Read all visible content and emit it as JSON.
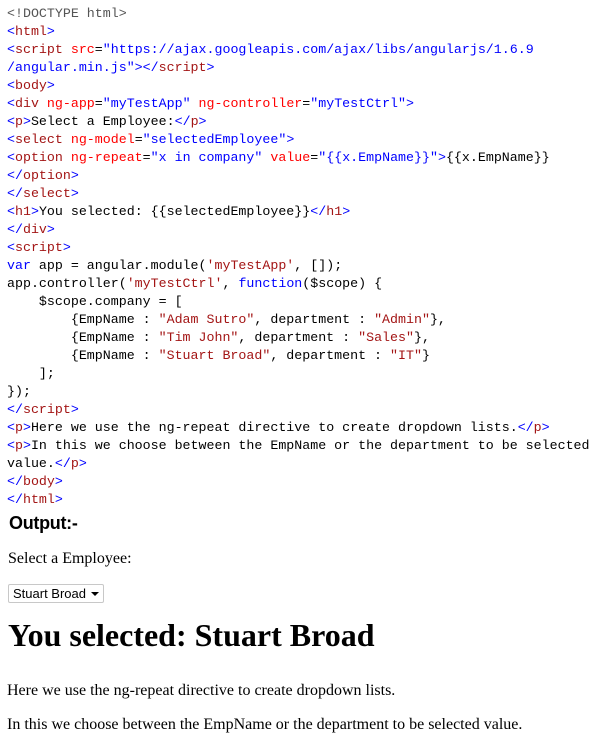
{
  "code": {
    "lines": [
      [
        [
          "d",
          "<!DOCTYPE html>"
        ]
      ],
      [
        [
          "b",
          "<"
        ],
        [
          "t",
          "html"
        ],
        [
          "b",
          ">"
        ]
      ],
      [
        [
          "b",
          "<"
        ],
        [
          "t",
          "script "
        ],
        [
          "a",
          "src"
        ],
        [
          "p",
          "="
        ],
        [
          "v",
          "\"https://ajax.googleapis.com/ajax/libs/angularjs/1.6.9"
        ]
      ],
      [
        [
          "v",
          "/angular.min.js\""
        ],
        [
          "b",
          "></"
        ],
        [
          "t",
          "script"
        ],
        [
          "b",
          ">"
        ]
      ],
      [
        [
          "b",
          "<"
        ],
        [
          "t",
          "body"
        ],
        [
          "b",
          ">"
        ]
      ],
      [
        [
          "b",
          "<"
        ],
        [
          "t",
          "div "
        ],
        [
          "a",
          "ng-app"
        ],
        [
          "p",
          "="
        ],
        [
          "v",
          "\"myTestApp\" "
        ],
        [
          "a",
          "ng-controller"
        ],
        [
          "p",
          "="
        ],
        [
          "v",
          "\"myTestCtrl\""
        ],
        [
          "b",
          ">"
        ]
      ],
      [
        [
          "b",
          "<"
        ],
        [
          "t",
          "p"
        ],
        [
          "b",
          ">"
        ],
        [
          "p",
          "Select a Employee:"
        ],
        [
          "b",
          "</"
        ],
        [
          "t",
          "p"
        ],
        [
          "b",
          ">"
        ]
      ],
      [
        [
          "b",
          "<"
        ],
        [
          "t",
          "select "
        ],
        [
          "a",
          "ng-model"
        ],
        [
          "p",
          "="
        ],
        [
          "v",
          "\"selectedEmployee\""
        ],
        [
          "b",
          ">"
        ]
      ],
      [
        [
          "b",
          "<"
        ],
        [
          "t",
          "option "
        ],
        [
          "a",
          "ng-repeat"
        ],
        [
          "p",
          "="
        ],
        [
          "v",
          "\"x in company\" "
        ],
        [
          "a",
          "value"
        ],
        [
          "p",
          "="
        ],
        [
          "v",
          "\"{{x.EmpName}}\""
        ],
        [
          "b",
          ">"
        ],
        [
          "p",
          "{{x.EmpName}}"
        ]
      ],
      [
        [
          "b",
          "</"
        ],
        [
          "t",
          "option"
        ],
        [
          "b",
          ">"
        ]
      ],
      [
        [
          "b",
          "</"
        ],
        [
          "t",
          "select"
        ],
        [
          "b",
          ">"
        ]
      ],
      [
        [
          "b",
          "<"
        ],
        [
          "t",
          "h1"
        ],
        [
          "b",
          ">"
        ],
        [
          "p",
          "You selected: {{selectedEmployee}}"
        ],
        [
          "b",
          "</"
        ],
        [
          "t",
          "h1"
        ],
        [
          "b",
          ">"
        ]
      ],
      [
        [
          "b",
          "</"
        ],
        [
          "t",
          "div"
        ],
        [
          "b",
          ">"
        ]
      ],
      [
        [
          "b",
          "<"
        ],
        [
          "t",
          "script"
        ],
        [
          "b",
          ">"
        ]
      ],
      [
        [
          "k",
          "var"
        ],
        [
          "p",
          " app = angular.module("
        ],
        [
          "s",
          "'myTestApp'"
        ],
        [
          "p",
          ", []);"
        ]
      ],
      [
        [
          "p",
          "app.controller("
        ],
        [
          "s",
          "'myTestCtrl'"
        ],
        [
          "p",
          ", "
        ],
        [
          "k",
          "function"
        ],
        [
          "p",
          "($scope) {"
        ]
      ],
      [
        [
          "p",
          "    $scope.company = ["
        ]
      ],
      [
        [
          "p",
          "        {EmpName : "
        ],
        [
          "s",
          "\"Adam Sutro\""
        ],
        [
          "p",
          ", department : "
        ],
        [
          "s",
          "\"Admin\""
        ],
        [
          "p",
          "},"
        ]
      ],
      [
        [
          "p",
          "        {EmpName : "
        ],
        [
          "s",
          "\"Tim John\""
        ],
        [
          "p",
          ", department : "
        ],
        [
          "s",
          "\"Sales\""
        ],
        [
          "p",
          "},"
        ]
      ],
      [
        [
          "p",
          "        {EmpName : "
        ],
        [
          "s",
          "\"Stuart Broad\""
        ],
        [
          "p",
          ", department : "
        ],
        [
          "s",
          "\"IT\""
        ],
        [
          "p",
          "}"
        ]
      ],
      [
        [
          "p",
          "    ];"
        ]
      ],
      [
        [
          "p",
          "});"
        ]
      ],
      [
        [
          "b",
          "</"
        ],
        [
          "t",
          "script"
        ],
        [
          "b",
          ">"
        ]
      ],
      [
        [
          "b",
          "<"
        ],
        [
          "t",
          "p"
        ],
        [
          "b",
          ">"
        ],
        [
          "p",
          "Here we use the ng-repeat directive to create dropdown lists."
        ],
        [
          "b",
          "</"
        ],
        [
          "t",
          "p"
        ],
        [
          "b",
          ">"
        ]
      ],
      [
        [
          "b",
          "<"
        ],
        [
          "t",
          "p"
        ],
        [
          "b",
          ">"
        ],
        [
          "p",
          "In this we choose between the EmpName or the department to be selected"
        ]
      ],
      [
        [
          "p",
          "value."
        ],
        [
          "b",
          "</"
        ],
        [
          "t",
          "p"
        ],
        [
          "b",
          ">"
        ]
      ],
      [
        [
          "b",
          "</"
        ],
        [
          "t",
          "body"
        ],
        [
          "b",
          ">"
        ]
      ],
      [
        [
          "b",
          "</"
        ],
        [
          "t",
          "html"
        ],
        [
          "b",
          ">"
        ]
      ]
    ]
  },
  "output": {
    "heading": "Output:-",
    "select_label": "Select a Employee:",
    "selected_value": "Stuart Broad",
    "h1": "You selected: Stuart Broad",
    "paragraphs": [
      "Here we use the ng-repeat directive to create dropdown lists.",
      "In this we choose between the EmpName or the department to be selected value."
    ]
  }
}
